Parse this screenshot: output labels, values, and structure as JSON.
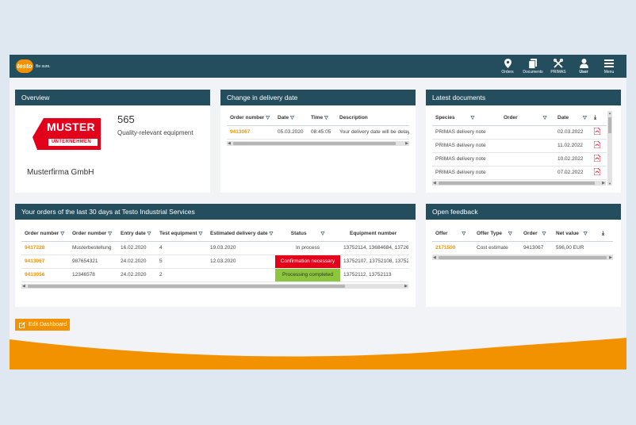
{
  "header": {
    "logo_text": "testo",
    "slogan": "Be sure.",
    "nav": [
      {
        "label": "Orders",
        "icon": "map-pin-icon"
      },
      {
        "label": "Documents",
        "icon": "documents-icon"
      },
      {
        "label": "PRIMAS",
        "icon": "tools-icon"
      },
      {
        "label": "User",
        "icon": "user-icon"
      },
      {
        "label": "Menu",
        "icon": "menu-icon"
      }
    ]
  },
  "overview": {
    "title": "Overview",
    "logo_line1": "MUSTER",
    "logo_line2": "UNTERNEHMEN",
    "count": "565",
    "count_label": "Quality-relevant equipment",
    "company": "Musterfirma GmbH"
  },
  "delivery": {
    "title": "Change in delivery date",
    "headers": [
      "Order number",
      "Date",
      "Time",
      "Description"
    ],
    "rows": [
      [
        "9413067",
        "05.03.2020",
        "08:45:05",
        "Your delivery date will be delayed"
      ]
    ]
  },
  "documents": {
    "title": "Latest documents",
    "headers": [
      "Species",
      "Order",
      "Date"
    ],
    "rows": [
      [
        "PRIMAS delivery note",
        "",
        "02.03.2022"
      ],
      [
        "PRIMAS delivery note",
        "",
        "11.02.2022"
      ],
      [
        "PRIMAS delivery note",
        "",
        "10.02.2022"
      ],
      [
        "PRIMAS delivery note",
        "",
        "07.02.2022"
      ]
    ]
  },
  "orders": {
    "title": "Your orders of the last 30 days at Testo Industrial Services",
    "headers": [
      "Order number",
      "Order number",
      "Entry date",
      "Test equipment",
      "Estimated delivery date",
      "Status",
      "Equipment number"
    ],
    "rows": [
      [
        "9417228",
        "Musterbestellung",
        "16.02.2020",
        "4",
        "19.03.2020",
        "In process",
        "13752114, 13684684, 13726"
      ],
      [
        "9413067",
        "987654321",
        "24.02.2020",
        "5",
        "12.03.2020",
        "Confirmation necessary",
        "13752107, 13752108, 13752"
      ],
      [
        "9413056",
        "12346578",
        "24.02.2020",
        "2",
        "",
        "Processing completed",
        "13752112, 13752113"
      ]
    ],
    "status_colors": {
      "In process": "#ffffff",
      "Confirmation necessary": "#e2001a",
      "Processing completed": "#8cc63f"
    }
  },
  "feedback": {
    "title": "Open feedback",
    "headers": [
      "Offer",
      "Offer Type",
      "Order",
      "Net value"
    ],
    "rows": [
      [
        "2171500",
        "Cost estimate",
        "9413067",
        "596,00 EUR"
      ]
    ]
  },
  "edit_button": "Edit Dashboard",
  "colors": {
    "accent": "#f39200",
    "header": "#244e5e",
    "background": "#f1f3f6"
  }
}
